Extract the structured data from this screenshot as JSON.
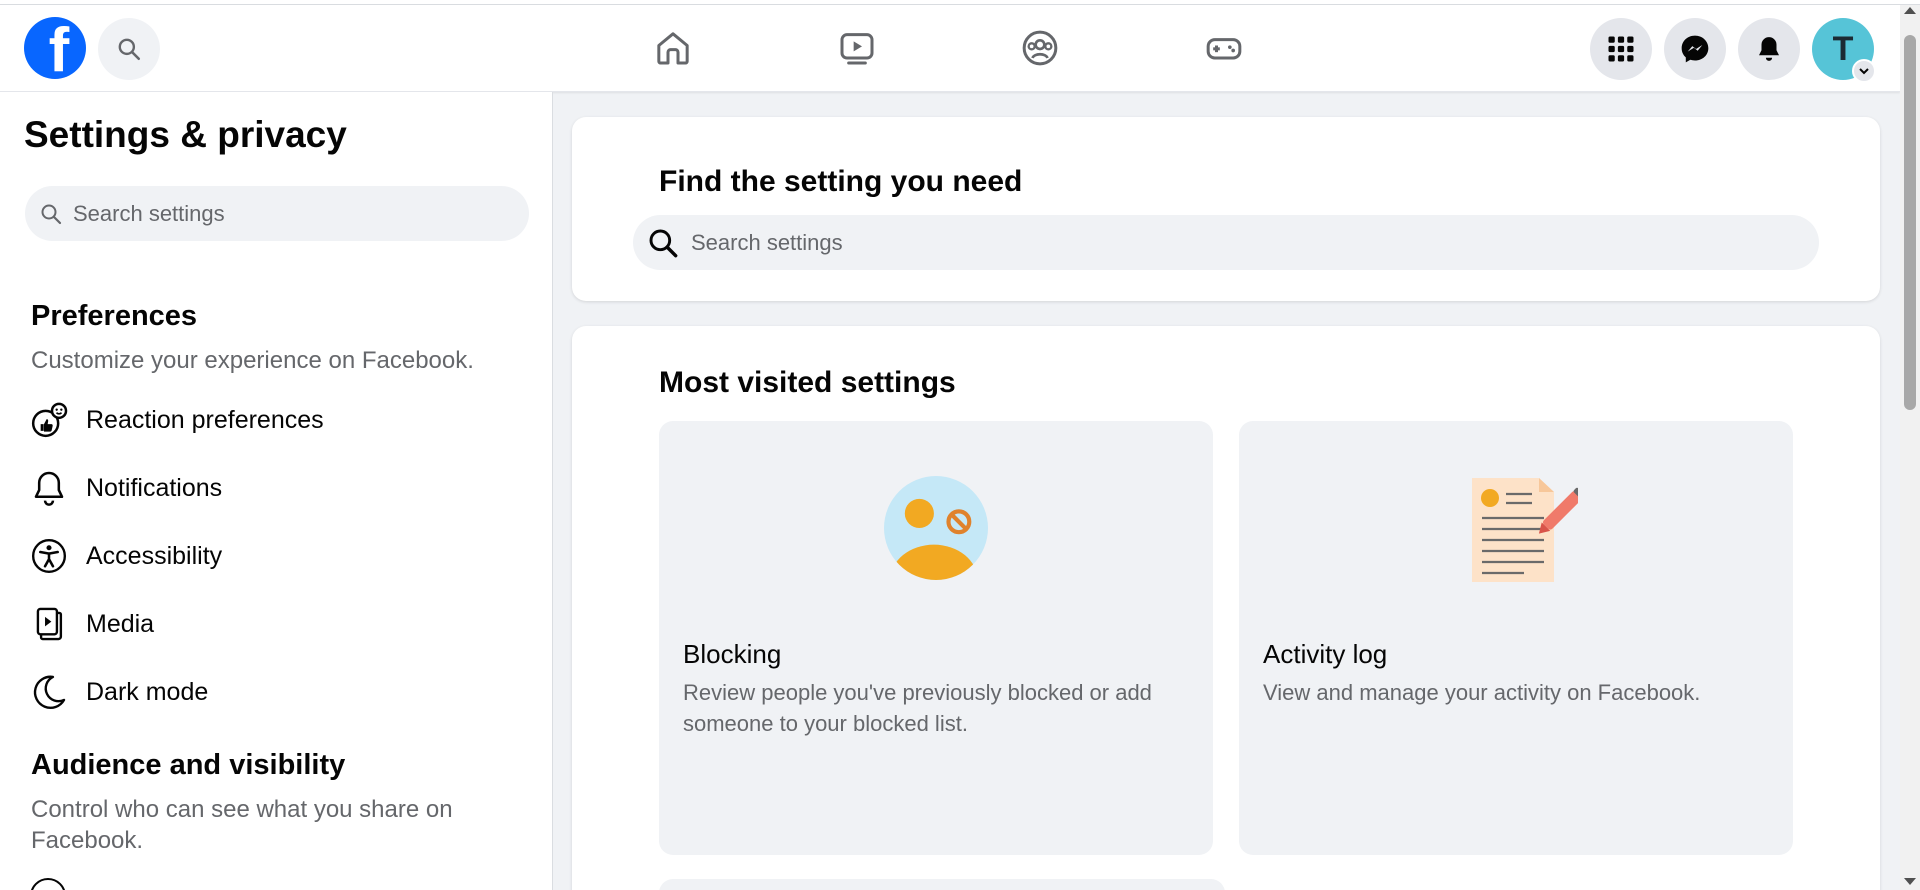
{
  "header": {
    "logo_letter": "f",
    "avatar_initial": "T",
    "icons": {
      "logo": "facebook-logo",
      "search": "search-icon",
      "home": "home-icon",
      "video": "video-icon",
      "groups": "groups-icon",
      "gaming": "gaming-icon",
      "menu": "menu-grid-icon",
      "messenger": "messenger-icon",
      "notifications": "bell-icon",
      "account": "chevron-down-icon"
    }
  },
  "sidebar": {
    "title": "Settings & privacy",
    "search_placeholder": "Search settings",
    "sections": [
      {
        "heading": "Preferences",
        "description": "Customize your experience on Facebook.",
        "items": [
          {
            "label": "Reaction preferences",
            "icon": "reaction-icon"
          },
          {
            "label": "Notifications",
            "icon": "bell-icon"
          },
          {
            "label": "Accessibility",
            "icon": "accessibility-icon"
          },
          {
            "label": "Media",
            "icon": "media-icon"
          },
          {
            "label": "Dark mode",
            "icon": "moon-icon"
          }
        ]
      },
      {
        "heading": "Audience and visibility",
        "description": "Control who can see what you share on Facebook."
      }
    ]
  },
  "main": {
    "find": {
      "title": "Find the setting you need",
      "search_placeholder": "Search settings"
    },
    "most_visited": {
      "title": "Most visited settings",
      "tiles": [
        {
          "title": "Blocking",
          "description": "Review people you've previously blocked or add someone to your blocked list.",
          "icon": "blocked-person-icon"
        },
        {
          "title": "Activity log",
          "description": "View and manage your activity on Facebook.",
          "icon": "activity-log-icon"
        }
      ]
    }
  },
  "colors": {
    "brand": "#0866ff",
    "background": "#f0f2f5",
    "secondary_text": "#65676b"
  }
}
